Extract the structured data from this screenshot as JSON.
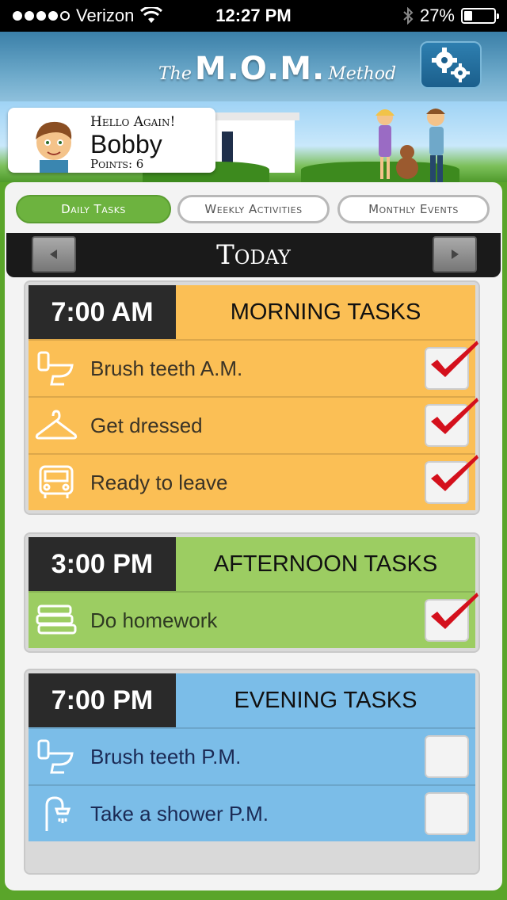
{
  "status_bar": {
    "carrier": "Verizon",
    "time": "12:27 PM",
    "battery": "27%"
  },
  "header": {
    "logo_the": "The",
    "logo_mom": "M.O.M.",
    "logo_method": "Method",
    "settings_icon": "gear-icon"
  },
  "greeting": {
    "hello": "Hello Again!",
    "name": "Bobby",
    "points": "Points: 6"
  },
  "tabs": [
    {
      "label": "Daily Tasks",
      "active": true
    },
    {
      "label": "Weekly Activities",
      "active": false
    },
    {
      "label": "Monthly Events",
      "active": false
    }
  ],
  "day": {
    "title": "Today",
    "prev_icon": "left-arrow-icon",
    "next_icon": "right-arrow-icon"
  },
  "groups": [
    {
      "time": "7:00 AM",
      "label": "MORNING TASKS",
      "color": "#fbbf55",
      "tasks": [
        {
          "label": "Brush teeth A.M.",
          "icon": "toilet-icon",
          "checked": true
        },
        {
          "label": "Get dressed",
          "icon": "hanger-icon",
          "checked": true
        },
        {
          "label": "Ready to leave",
          "icon": "bus-icon",
          "checked": true
        }
      ]
    },
    {
      "time": "3:00 PM",
      "label": "AFTERNOON TASKS",
      "color": "#9ccd62",
      "tasks": [
        {
          "label": "Do homework",
          "icon": "books-icon",
          "checked": true
        }
      ]
    },
    {
      "time": "7:00 PM",
      "label": "EVENING TASKS",
      "color": "#7bbde8",
      "tasks": [
        {
          "label": "Brush teeth P.M.",
          "icon": "toilet-icon",
          "checked": false
        },
        {
          "label": "Take a shower P.M.",
          "icon": "shower-icon",
          "checked": false
        }
      ]
    }
  ],
  "colors": {
    "check": "#d4101c",
    "header_blue": "#3a7fa8",
    "tab_active": "#6db33f",
    "border_green": "#5aa52a"
  }
}
